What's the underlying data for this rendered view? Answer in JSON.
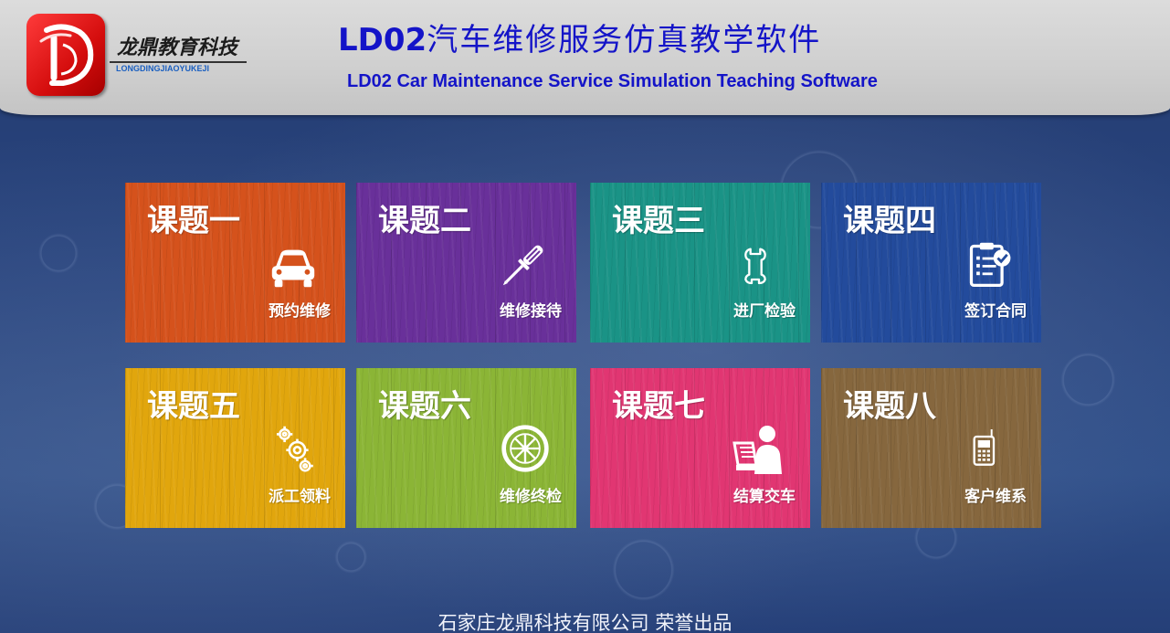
{
  "header": {
    "logo_cn": "龙鼎教育科技",
    "logo_en": "LONGDINGJIAOYUKEJI",
    "title_prefix": "LD02",
    "title_cn": "汽车维修服务仿真教学软件",
    "title_en": "LD02 Car Maintenance Service Simulation Teaching Software"
  },
  "tiles": [
    {
      "title": "课题一",
      "label": "预约维修",
      "color": "#d5521c",
      "icon": "car-icon"
    },
    {
      "title": "课题二",
      "label": "维修接待",
      "color": "#69309a",
      "icon": "screwdriver-icon"
    },
    {
      "title": "课题三",
      "label": "进厂检验",
      "color": "#1a9386",
      "icon": "wrench-icon"
    },
    {
      "title": "课题四",
      "label": "签订合同",
      "color": "#234b9c",
      "icon": "contract-icon"
    },
    {
      "title": "课题五",
      "label": "派工领料",
      "color": "#e1a60d",
      "icon": "gears-icon"
    },
    {
      "title": "课题六",
      "label": "维修终检",
      "color": "#8bb536",
      "icon": "wheel-icon"
    },
    {
      "title": "课题七",
      "label": "结算交车",
      "color": "#e13672",
      "icon": "person-laptop-icon"
    },
    {
      "title": "课题八",
      "label": "客户维系",
      "color": "#86673e",
      "icon": "phone-icon"
    }
  ],
  "footer": {
    "text": "石家庄龙鼎科技有限公司 荣誉出品"
  }
}
